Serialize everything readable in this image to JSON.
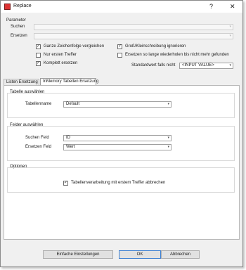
{
  "window": {
    "title": "Replace",
    "help_label": "?",
    "close_label": "✕"
  },
  "parameter": {
    "title": "Parameter",
    "suchen_label": "Suchen",
    "ersetzen_label": "Ersetzen",
    "checkboxes": [
      {
        "label": "Ganze Zeichenfolge vergleichen",
        "checked": true
      },
      {
        "label": "Nur ersten Treffer",
        "checked": false
      },
      {
        "label": "Komplett ersetzen",
        "checked": true
      },
      {
        "label": "Groß/Kleinschreibung ignorieren",
        "checked": true
      },
      {
        "label": "Ersetzen so lange wiederholen bis nicht mehr gefunden",
        "checked": false
      }
    ],
    "standardwert_label": "Standardwert falls nicht",
    "standardwert_value": "<INPUT VALUE>"
  },
  "tabs": [
    {
      "label": "Listen Ersetzung",
      "active": false
    },
    {
      "label": "InMemory Tabellen Ersetzung",
      "active": true
    }
  ],
  "tabelle": {
    "title": "Tabelle auswählen",
    "name_label": "Tabellenname",
    "name_value": "Default"
  },
  "felder": {
    "title": "Felder auswählen",
    "suchen_label": "Suchen Feld",
    "suchen_value": "ID",
    "ersetzen_label": "Ersetzen Feld",
    "ersetzen_value": "Wert"
  },
  "optionen": {
    "title": "Optionen",
    "checkbox_label": "Tabellenverarbeitung mit erstem Treffer abbrechen",
    "checked": true
  },
  "buttons": {
    "simple": "Einfache Einstellungen",
    "ok": "OK",
    "cancel": "Abbrechen"
  },
  "icons": {
    "check": "✓",
    "dropdown": "▾"
  }
}
